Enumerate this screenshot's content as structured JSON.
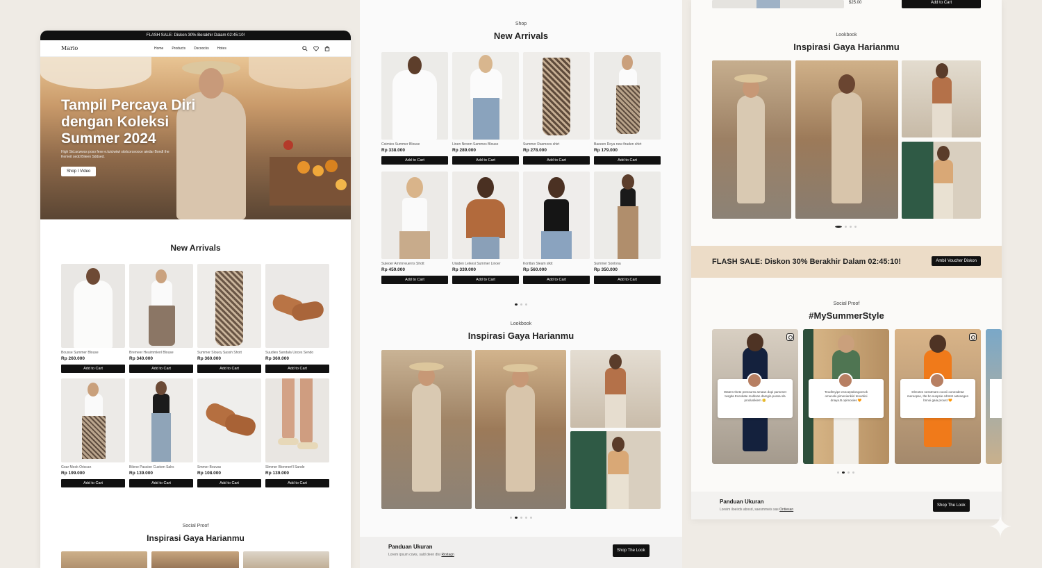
{
  "panel_a": {
    "flash": "FLASH SALE: Diskon 30% Berakhir Dalam 02:45:10!",
    "logo": "Mario",
    "nav": [
      "Home",
      "Products",
      "Dscoocks",
      "Hotes"
    ],
    "hero_title": "Tampil Percaya Diri dengan Koleksi Summer 2024",
    "hero_sub": "High Sid.acwwss poso fexe e.tuiciwiwt siislcorceooce aiedar Bondl the Kemeit sedd Biieen Sddsed.",
    "hero_button": "Shop I Video",
    "new_arrivals_title": "New Arrivals",
    "products": [
      {
        "name": "Bousse Summer Blouse",
        "price": "Rp 260.000"
      },
      {
        "name": "Bremeer Heuimmlenl Blouse",
        "price": "Rp 340.000"
      },
      {
        "name": "Summer Slouoy Sassh Shott",
        "price": "Rp 360.000"
      },
      {
        "name": "Suudies Sandala Uoces Sendo",
        "price": "Rp 360.000"
      },
      {
        "name": "Goar Mook Oriscan",
        "price": "Rp 199.000"
      },
      {
        "name": "Bilene Passion Custom Salrs",
        "price": "Rp 139.000"
      },
      {
        "name": "Smmer Bouvas",
        "price": "Rp 108.000"
      },
      {
        "name": "Slmmer Blonmert'l Sande",
        "price": "Rp 139.000"
      }
    ],
    "add_to_cart": "Add to Cart",
    "social_kicker": "Social Proof",
    "social_title": "Inspirasi Gaya Harianmu"
  },
  "panel_b": {
    "kicker": "Shop",
    "title": "New Arrivals",
    "products": [
      {
        "name": "Coimtes Summer Blouse",
        "price": "Rp 338.000"
      },
      {
        "name": "Linen Nroom Sammes Blouse",
        "price": "Rp 289.000"
      },
      {
        "name": "Summer Rasmoos shirt",
        "price": "Rp 278.000"
      },
      {
        "name": "Baeeen Roya new firaden shirt",
        "price": "Rp 179.000"
      },
      {
        "name": "Suleoer Ammrreuerns Shott",
        "price": "Rp 459.000"
      },
      {
        "name": "Uiiaden Leikesi Summer Linoer",
        "price": "Rp 339.000"
      },
      {
        "name": "Kontlan Sleam slkit",
        "price": "Rp 560.000"
      },
      {
        "name": "Summer Sonlona",
        "price": "Rp 350.000"
      }
    ],
    "add_to_cart": "Add to Cart",
    "look_kicker": "Lookbook",
    "look_title": "Inspirasi Gaya Harianmu",
    "guide_title": "Panduan Ukuran",
    "guide_text": "Lorem ipsum cows, sald deen dlsi",
    "guide_link": "Rioitagn",
    "shop_look": "Shop The Look"
  },
  "panel_c": {
    "top_price": "$25.00",
    "top_button": "Add to Cart",
    "look_kicker": "Lookbook",
    "look_title": "Inspirasi Gaya Harianmu",
    "flash": "FLASH SALE: Diskon 30% Berakhir Dalam 02:45:10!",
    "voucher": "Ambil Voucher Diskon",
    "social_kicker": "Social Proof",
    "social_title": "#MySummerStyle",
    "quotes": [
      "Waters thete pressurss arnaan dopi pamenet tusgita Eceskate multisan damgin.pussa sla produsikiem 😊",
      "Teodlmyipe esnoeptdongoenck omuceki.pimenienkiiri tenurkisi dnaya.B.opimosies 🧡",
      "Dlreotes nesstmam coonii oonesdetut mereopse, Ilte bo sunpsie cdmtst oetesegen bnnoi gaia proust 🧡"
    ],
    "guide_title": "Panduan Ukuran",
    "guide_text": "Loreim iloeirds abosd, saesmmeis sas",
    "guide_link": "Ontiesan",
    "shop_look": "Shop The Look"
  },
  "colors": {
    "dark": "#111111",
    "sand": "#ecdcc7",
    "bg": "#efebe5"
  }
}
